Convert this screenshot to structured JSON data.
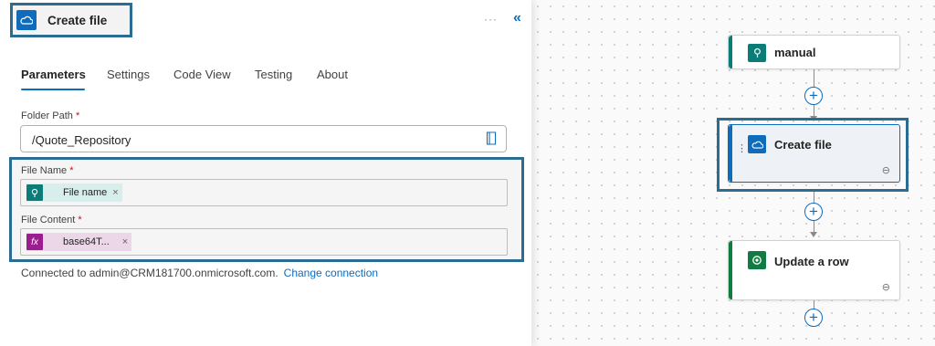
{
  "panel": {
    "title": "Create file",
    "more_label": "···",
    "collapse_label": "«",
    "tabs": [
      {
        "label": "Parameters",
        "active": true
      },
      {
        "label": "Settings",
        "active": false
      },
      {
        "label": "Code View",
        "active": false
      },
      {
        "label": "Testing",
        "active": false
      },
      {
        "label": "About",
        "active": false
      }
    ],
    "folder_path": {
      "label": "Folder Path",
      "required_mark": "*",
      "value": "/Quote_Repository"
    },
    "file_name": {
      "label": "File Name",
      "required_mark": "*",
      "token_label": "File name",
      "token_remove": "×"
    },
    "file_content": {
      "label": "File Content",
      "required_mark": "*",
      "token_label": "base64T...",
      "token_icon_text": "fx",
      "token_remove": "×"
    },
    "connection": {
      "text": "Connected to admin@CRM181700.onmicrosoft.com.",
      "link": "Change connection"
    }
  },
  "flow": {
    "nodes": [
      {
        "title": "manual",
        "accent": "#0a7d79"
      },
      {
        "title": "Create file",
        "accent": "#0f6cbd"
      },
      {
        "title": "Update a row",
        "accent": "#107c41"
      }
    ],
    "add_symbol": "+",
    "link_symbol": "⊖",
    "drag_symbol": "⋮"
  },
  "colors": {
    "primary": "#0f6cbd",
    "highlight": "#2b6c93",
    "trigger": "#0a7d79",
    "expression": "#9c1d8f",
    "dataverse": "#107c41"
  }
}
